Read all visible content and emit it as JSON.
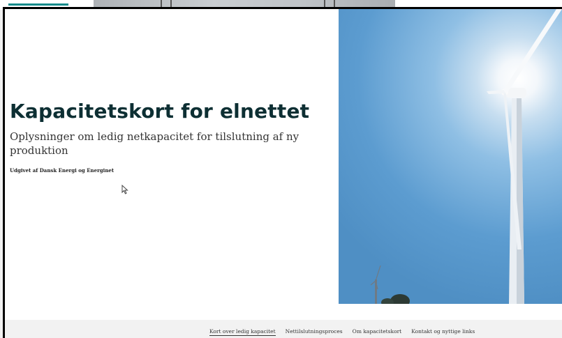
{
  "hero": {
    "title": "Kapacitetskort for elnettet",
    "subtitle": "Oplysninger om ledig netkapacitet for tilslutning af ny produktion",
    "publisher": "Udgivet af Dansk Energi og Energinet"
  },
  "image": {
    "subject": "wind-turbine-photo"
  },
  "footer": {
    "nav": [
      {
        "label": "Kort over ledig kapacitet",
        "active": true
      },
      {
        "label": "Nettilslutningsproces",
        "active": false
      },
      {
        "label": "Om kapacitetskort",
        "active": false
      },
      {
        "label": "Kontakt og nyttige links",
        "active": false
      }
    ]
  },
  "colors": {
    "title": "#0d2f33",
    "accent": "#0f8a8a",
    "footer_bg": "#f2f2f2"
  }
}
